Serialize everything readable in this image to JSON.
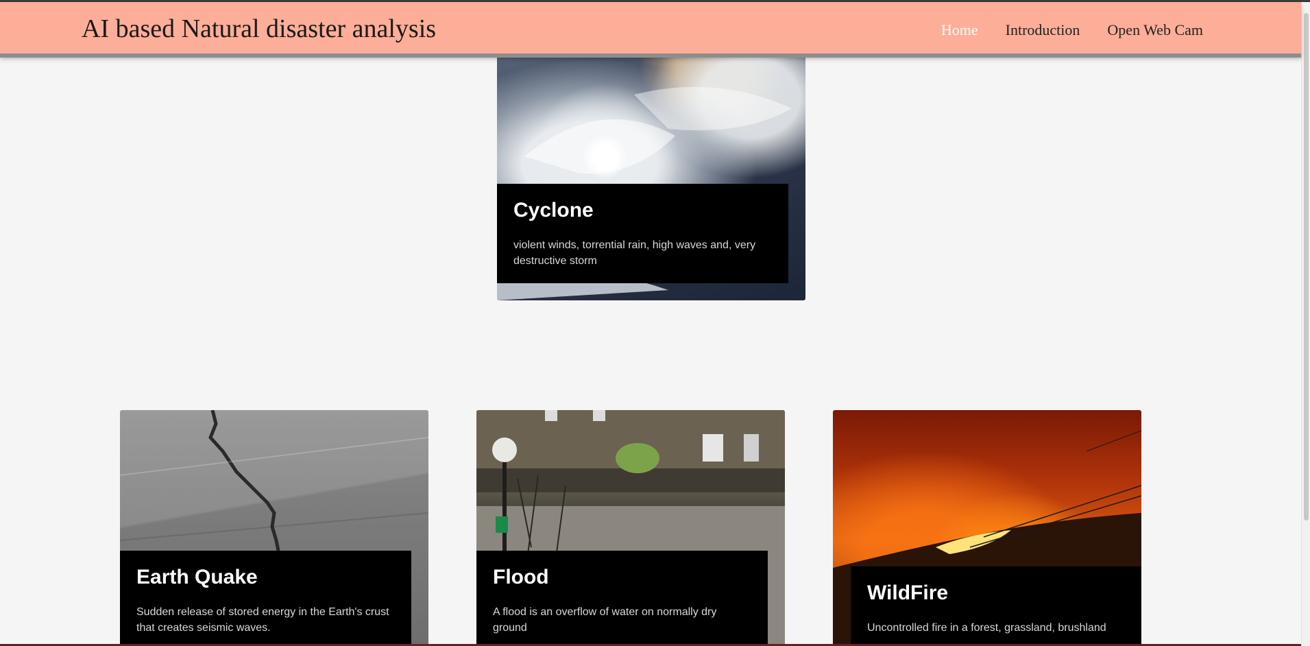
{
  "navbar": {
    "brand": "AI based Natural disaster analysis",
    "links": [
      {
        "label": "Home",
        "active": true
      },
      {
        "label": "Introduction",
        "active": false
      },
      {
        "label": "Open Web Cam",
        "active": false
      }
    ]
  },
  "cards": [
    {
      "title": "Cyclone",
      "description": "violent winds, torrential rain, high waves and, very destructive storm"
    },
    {
      "title": "Earth Quake",
      "description": "Sudden release of stored energy in the Earth's crust that creates seismic waves."
    },
    {
      "title": "Flood",
      "description": "A flood is an overflow of water on normally dry ground"
    },
    {
      "title": "WildFire",
      "description": "Uncontrolled fire in a forest, grassland, brushland"
    }
  ],
  "colors": {
    "navbar_bg": "#fdae98",
    "page_bg": "#f5f5f5",
    "caption_bg": "#000000",
    "active_link": "#ffffff"
  }
}
